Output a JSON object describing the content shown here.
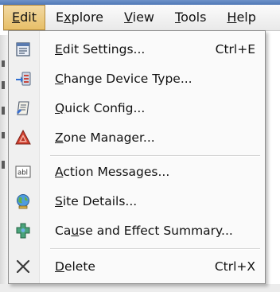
{
  "menubar": {
    "items": [
      {
        "pre": "",
        "ul": "E",
        "post": "dit",
        "active": true
      },
      {
        "pre": "E",
        "ul": "x",
        "post": "plore",
        "active": false
      },
      {
        "pre": "",
        "ul": "V",
        "post": "iew",
        "active": false
      },
      {
        "pre": "",
        "ul": "T",
        "post": "ools",
        "active": false
      },
      {
        "pre": "",
        "ul": "H",
        "post": "elp",
        "active": false
      }
    ]
  },
  "menu": {
    "items": [
      {
        "pre": "",
        "ul": "E",
        "post": "dit Settings...",
        "shortcut": "Ctrl+E",
        "icon": "settings-window-icon"
      },
      {
        "pre": "",
        "ul": "C",
        "post": "hange Device Type...",
        "shortcut": "",
        "icon": "change-device-icon"
      },
      {
        "pre": "",
        "ul": "Q",
        "post": "uick Config...",
        "shortcut": "",
        "icon": "quick-config-icon"
      },
      {
        "pre": "",
        "ul": "Z",
        "post": "one Manager...",
        "shortcut": "",
        "icon": "zone-manager-icon"
      },
      {
        "pre": "",
        "ul": "A",
        "post": "ction Messages...",
        "shortcut": "",
        "icon": "text-field-icon"
      },
      {
        "pre": "",
        "ul": "S",
        "post": "ite Details...",
        "shortcut": "",
        "icon": "globe-icon"
      },
      {
        "pre": "Ca",
        "ul": "u",
        "post": "se and Effect Summary...",
        "shortcut": "",
        "icon": "puzzle-icon"
      },
      {
        "pre": "",
        "ul": "D",
        "post": "elete",
        "shortcut": "Ctrl+X",
        "icon": "delete-x-icon"
      }
    ],
    "text_field_icon_text": "abl"
  },
  "colors": {
    "active_menu": "#e7bf68",
    "title_bar": "#4f78b6"
  }
}
